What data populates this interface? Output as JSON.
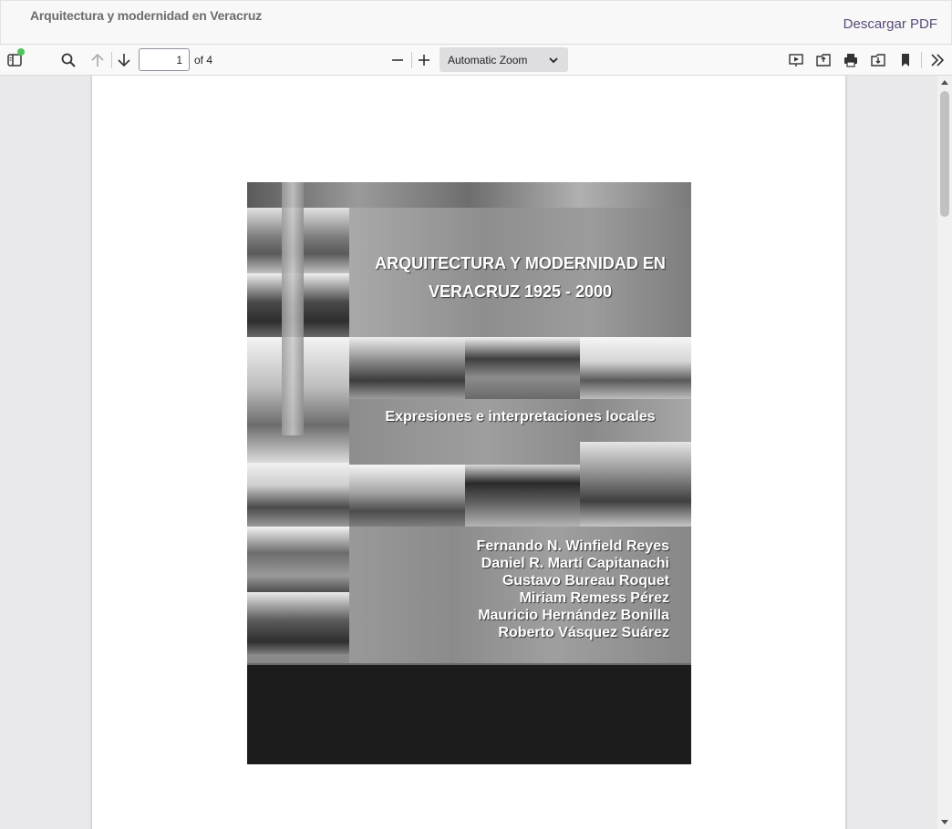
{
  "header": {
    "title": "Arquitectura y modernidad en Veracruz",
    "download_label": "Descargar PDF"
  },
  "toolbar": {
    "page_number": "1",
    "page_count": "of 4",
    "zoom": "Automatic Zoom"
  },
  "cover": {
    "title_line1": "ARQUITECTURA  Y MODERNIDAD EN",
    "title_line2": "VERACRUZ 1925 - 2000",
    "subtitle": "Expresiones e interpretaciones locales",
    "authors": [
      "Fernando  N.  Winfield  Reyes",
      "Daniel R. Martí  Capitanachi",
      "Gustavo Bureau Roquet",
      "Miriam Remess Pérez",
      "Mauricio Hernández  Bonilla",
      "Roberto  Vásquez  Suárez"
    ]
  }
}
